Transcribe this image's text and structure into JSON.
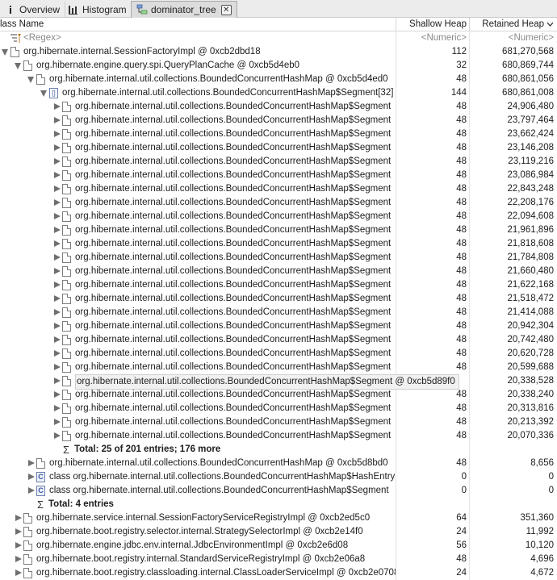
{
  "tabs": [
    {
      "label": "Overview",
      "icon": "info-icon",
      "active": false
    },
    {
      "label": "Histogram",
      "icon": "histogram-icon",
      "active": false
    },
    {
      "label": "dominator_tree",
      "icon": "tree-icon",
      "active": true
    }
  ],
  "columns": {
    "name": "lass Name",
    "shallow": "Shallow Heap",
    "retained": "Retained Heap",
    "sort_icon": "chevron-down-icon"
  },
  "filter": {
    "name": "<Regex>",
    "shallow": "<Numeric>",
    "retained": "<Numeric>"
  },
  "rows": [
    {
      "indent": 0,
      "arrow": "open",
      "icon": "doc",
      "name": "org.hibernate.internal.SessionFactoryImpl @ 0xcb2dbd18",
      "shallow": "112",
      "retained": "681,270,568"
    },
    {
      "indent": 1,
      "arrow": "open",
      "icon": "doc",
      "name": "org.hibernate.engine.query.spi.QueryPlanCache @ 0xcb5d4eb0",
      "shallow": "32",
      "retained": "680,869,744"
    },
    {
      "indent": 2,
      "arrow": "open",
      "icon": "doc",
      "name": "org.hibernate.internal.util.collections.BoundedConcurrentHashMap @ 0xcb5d4ed0",
      "shallow": "48",
      "retained": "680,861,056"
    },
    {
      "indent": 3,
      "arrow": "open",
      "icon": "arr",
      "name": "org.hibernate.internal.util.collections.BoundedConcurrentHashMap$Segment[32] @ 0xcb5d4f00",
      "shallow": "144",
      "retained": "680,861,008"
    },
    {
      "indent": 4,
      "arrow": "closed",
      "icon": "doc",
      "name": "org.hibernate.internal.util.collections.BoundedConcurrentHashMap$Segment",
      "shallow": "48",
      "retained": "24,906,480"
    },
    {
      "indent": 4,
      "arrow": "closed",
      "icon": "doc",
      "name": "org.hibernate.internal.util.collections.BoundedConcurrentHashMap$Segment",
      "shallow": "48",
      "retained": "23,797,464"
    },
    {
      "indent": 4,
      "arrow": "closed",
      "icon": "doc",
      "name": "org.hibernate.internal.util.collections.BoundedConcurrentHashMap$Segment",
      "shallow": "48",
      "retained": "23,662,424"
    },
    {
      "indent": 4,
      "arrow": "closed",
      "icon": "doc",
      "name": "org.hibernate.internal.util.collections.BoundedConcurrentHashMap$Segment",
      "shallow": "48",
      "retained": "23,146,208"
    },
    {
      "indent": 4,
      "arrow": "closed",
      "icon": "doc",
      "name": "org.hibernate.internal.util.collections.BoundedConcurrentHashMap$Segment",
      "shallow": "48",
      "retained": "23,119,216"
    },
    {
      "indent": 4,
      "arrow": "closed",
      "icon": "doc",
      "name": "org.hibernate.internal.util.collections.BoundedConcurrentHashMap$Segment",
      "shallow": "48",
      "retained": "23,086,984"
    },
    {
      "indent": 4,
      "arrow": "closed",
      "icon": "doc",
      "name": "org.hibernate.internal.util.collections.BoundedConcurrentHashMap$Segment",
      "shallow": "48",
      "retained": "22,843,248"
    },
    {
      "indent": 4,
      "arrow": "closed",
      "icon": "doc",
      "name": "org.hibernate.internal.util.collections.BoundedConcurrentHashMap$Segment",
      "shallow": "48",
      "retained": "22,208,176"
    },
    {
      "indent": 4,
      "arrow": "closed",
      "icon": "doc",
      "name": "org.hibernate.internal.util.collections.BoundedConcurrentHashMap$Segment",
      "shallow": "48",
      "retained": "22,094,608"
    },
    {
      "indent": 4,
      "arrow": "closed",
      "icon": "doc",
      "name": "org.hibernate.internal.util.collections.BoundedConcurrentHashMap$Segment",
      "shallow": "48",
      "retained": "21,961,896"
    },
    {
      "indent": 4,
      "arrow": "closed",
      "icon": "doc",
      "name": "org.hibernate.internal.util.collections.BoundedConcurrentHashMap$Segment",
      "shallow": "48",
      "retained": "21,818,608"
    },
    {
      "indent": 4,
      "arrow": "closed",
      "icon": "doc",
      "name": "org.hibernate.internal.util.collections.BoundedConcurrentHashMap$Segment",
      "shallow": "48",
      "retained": "21,784,808"
    },
    {
      "indent": 4,
      "arrow": "closed",
      "icon": "doc",
      "name": "org.hibernate.internal.util.collections.BoundedConcurrentHashMap$Segment",
      "shallow": "48",
      "retained": "21,660,480"
    },
    {
      "indent": 4,
      "arrow": "closed",
      "icon": "doc",
      "name": "org.hibernate.internal.util.collections.BoundedConcurrentHashMap$Segment",
      "shallow": "48",
      "retained": "21,622,168"
    },
    {
      "indent": 4,
      "arrow": "closed",
      "icon": "doc",
      "name": "org.hibernate.internal.util.collections.BoundedConcurrentHashMap$Segment",
      "shallow": "48",
      "retained": "21,518,472"
    },
    {
      "indent": 4,
      "arrow": "closed",
      "icon": "doc",
      "name": "org.hibernate.internal.util.collections.BoundedConcurrentHashMap$Segment",
      "shallow": "48",
      "retained": "21,414,088"
    },
    {
      "indent": 4,
      "arrow": "closed",
      "icon": "doc",
      "name": "org.hibernate.internal.util.collections.BoundedConcurrentHashMap$Segment",
      "shallow": "48",
      "retained": "20,942,304"
    },
    {
      "indent": 4,
      "arrow": "closed",
      "icon": "doc",
      "name": "org.hibernate.internal.util.collections.BoundedConcurrentHashMap$Segment",
      "shallow": "48",
      "retained": "20,742,480"
    },
    {
      "indent": 4,
      "arrow": "closed",
      "icon": "doc",
      "name": "org.hibernate.internal.util.collections.BoundedConcurrentHashMap$Segment",
      "shallow": "48",
      "retained": "20,620,728"
    },
    {
      "indent": 4,
      "arrow": "closed",
      "icon": "doc",
      "name": "org.hibernate.internal.util.collections.BoundedConcurrentHashMap$Segment",
      "shallow": "48",
      "retained": "20,599,688"
    },
    {
      "indent": 4,
      "arrow": "closed",
      "icon": "doc",
      "name": "org.hibernate.internal.util.collections.BoundedConcurrentHashMap$Segment @ 0xcb5d89f0",
      "shallow": "48",
      "retained": "20,338,528",
      "tooltip": true
    },
    {
      "indent": 4,
      "arrow": "closed",
      "icon": "doc",
      "name": "org.hibernate.internal.util.collections.BoundedConcurrentHashMap$Segment",
      "shallow": "48",
      "retained": "20,338,240"
    },
    {
      "indent": 4,
      "arrow": "closed",
      "icon": "doc",
      "name": "org.hibernate.internal.util.collections.BoundedConcurrentHashMap$Segment",
      "shallow": "48",
      "retained": "20,313,816"
    },
    {
      "indent": 4,
      "arrow": "closed",
      "icon": "doc",
      "name": "org.hibernate.internal.util.collections.BoundedConcurrentHashMap$Segment",
      "shallow": "48",
      "retained": "20,213,392"
    },
    {
      "indent": 4,
      "arrow": "closed",
      "icon": "doc",
      "name": "org.hibernate.internal.util.collections.BoundedConcurrentHashMap$Segment",
      "shallow": "48",
      "retained": "20,070,336"
    },
    {
      "indent": 4,
      "arrow": "none",
      "icon": "total-more",
      "name": "Total: 25 of 201 entries; 176 more",
      "shallow": "",
      "retained": "",
      "bold": true
    },
    {
      "indent": 2,
      "arrow": "closed",
      "icon": "doc",
      "name": "org.hibernate.internal.util.collections.BoundedConcurrentHashMap @ 0xcb5d8bd0",
      "shallow": "48",
      "retained": "8,656"
    },
    {
      "indent": 2,
      "arrow": "closed",
      "icon": "cls",
      "name": "class org.hibernate.internal.util.collections.BoundedConcurrentHashMap$HashEntry",
      "shallow": "0",
      "retained": "0"
    },
    {
      "indent": 2,
      "arrow": "closed",
      "icon": "cls",
      "name": "class org.hibernate.internal.util.collections.BoundedConcurrentHashMap$Segment",
      "shallow": "0",
      "retained": "0"
    },
    {
      "indent": 2,
      "arrow": "none",
      "icon": "sum",
      "name": "Total: 4 entries",
      "shallow": "",
      "retained": "",
      "bold": true
    },
    {
      "indent": 1,
      "arrow": "closed",
      "icon": "doc",
      "name": "org.hibernate.service.internal.SessionFactoryServiceRegistryImpl @ 0xcb2ed5c0",
      "shallow": "64",
      "retained": "351,360"
    },
    {
      "indent": 1,
      "arrow": "closed",
      "icon": "doc",
      "name": "org.hibernate.boot.registry.selector.internal.StrategySelectorImpl @ 0xcb2e14f0",
      "shallow": "24",
      "retained": "11,992"
    },
    {
      "indent": 1,
      "arrow": "closed",
      "icon": "doc",
      "name": "org.hibernate.engine.jdbc.env.internal.JdbcEnvironmentImpl @ 0xcb2e6d08",
      "shallow": "56",
      "retained": "10,120"
    },
    {
      "indent": 1,
      "arrow": "closed",
      "icon": "doc",
      "name": "org.hibernate.boot.registry.internal.StandardServiceRegistryImpl @ 0xcb2e06a8",
      "shallow": "48",
      "retained": "4,696"
    },
    {
      "indent": 1,
      "arrow": "closed",
      "icon": "doc",
      "name": "org.hibernate.boot.registry.classloading.internal.ClassLoaderServiceImpl @ 0xcb2e0708",
      "shallow": "24",
      "retained": "4,672"
    }
  ]
}
